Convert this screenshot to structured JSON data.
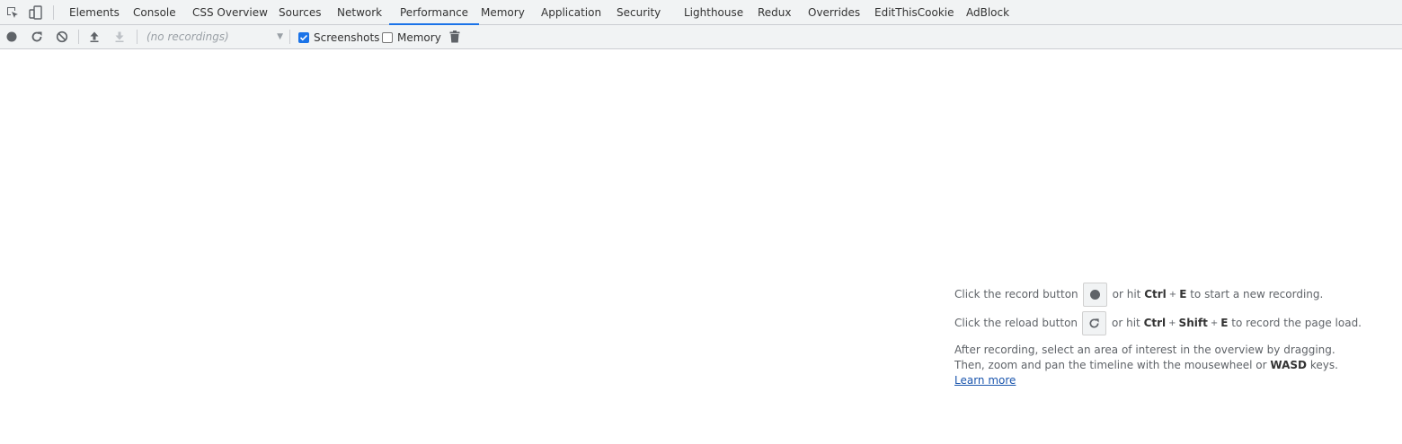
{
  "tabs": [
    {
      "label": "Elements",
      "active": false
    },
    {
      "label": "Console",
      "active": false
    },
    {
      "label": "CSS Overview",
      "active": false
    },
    {
      "label": "Sources",
      "active": false
    },
    {
      "label": "Network",
      "active": false
    },
    {
      "label": "Performance",
      "active": true
    },
    {
      "label": "Memory",
      "active": false
    },
    {
      "label": "Application",
      "active": false
    },
    {
      "label": "Security",
      "active": false
    },
    {
      "label": "Lighthouse",
      "active": false
    },
    {
      "label": "Redux",
      "active": false
    },
    {
      "label": "Overrides",
      "active": false
    },
    {
      "label": "EditThisCookie",
      "active": false
    },
    {
      "label": "AdBlock",
      "active": false
    }
  ],
  "toolbar": {
    "recordings_placeholder": "(no recordings)",
    "screenshots_label": "Screenshots",
    "screenshots_checked": true,
    "memory_label": "Memory",
    "memory_checked": false
  },
  "instructions": {
    "record_prefix": "Click the record button",
    "record_mid": "or hit",
    "record_key1": "Ctrl",
    "record_plus": "+",
    "record_key2": "E",
    "record_suffix": "to start a new recording.",
    "reload_prefix": "Click the reload button",
    "reload_mid": "or hit",
    "reload_key1": "Ctrl",
    "reload_plus1": "+",
    "reload_key2": "Shift",
    "reload_plus2": "+",
    "reload_key3": "E",
    "reload_suffix": "to record the page load.",
    "after_line1": "After recording, select an area of interest in the overview by dragging.",
    "after_line2_prefix": "Then, zoom and pan the timeline with the mousewheel or",
    "after_line2_key": "WASD",
    "after_line2_suffix": "keys.",
    "learn_more": "Learn more"
  },
  "colors": {
    "accent": "#1a73e8",
    "toolbar_bg": "#f1f3f4",
    "link": "#1a55ad"
  }
}
